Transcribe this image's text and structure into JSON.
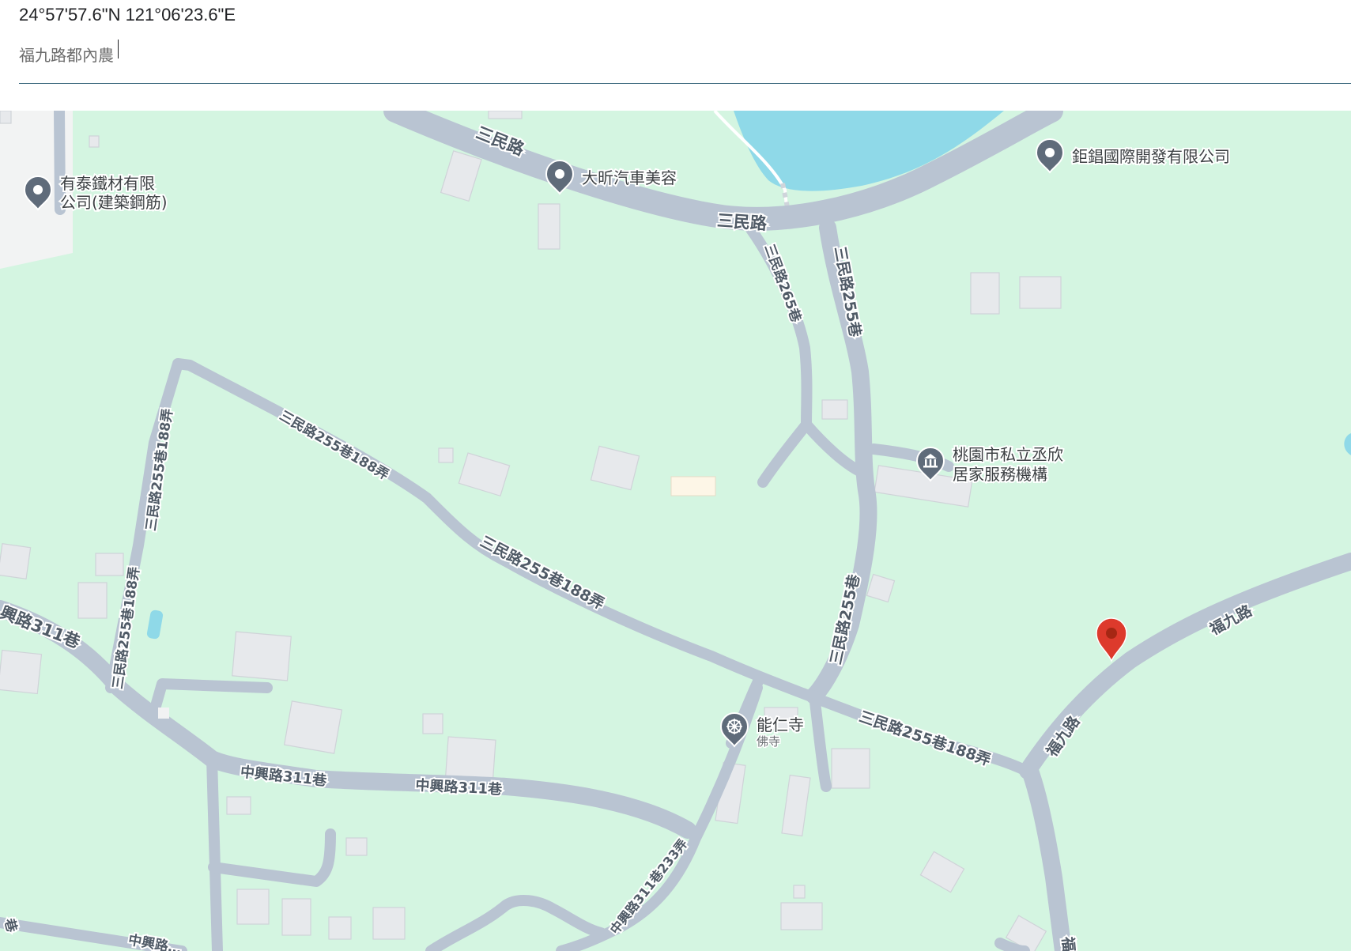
{
  "header": {
    "coordinates": "24°57'57.6\"N 121°06'23.6\"E",
    "search_value": "福九路都內農"
  },
  "map": {
    "colors": {
      "land": "#d4f5e1",
      "road": "#b9c4d2",
      "water": "#8fd9e8",
      "building": "#e7e9ec",
      "marker": "#dd3a2c"
    },
    "road_labels": {
      "sanmin_top_left": "三民路",
      "sanmin_top_mid": "三民路",
      "sanmin_265": "三民路265巷",
      "sanmin_255_top": "三民路255巷",
      "sanmin_255_bottom": "三民路255巷",
      "lane188_upper": "三民路255巷188弄",
      "lane188_mid": "三民路255巷188弄",
      "lane188_lower": "三民路255巷188弄",
      "lane188_vertical": "三民路255巷188弄",
      "lane188_vertical2": "三民路255巷188弄",
      "zhongxing311_left": "興路311巷",
      "zhongxing311_a": "中興路311巷",
      "zhongxing311_b": "中興路311巷",
      "zhongxing233": "中興路311巷233弄",
      "zhongxing_bottom": "中興路…",
      "fujiu_upper": "福九路",
      "fujiu_lower": "福九路",
      "fujiu_bottom": "福",
      "edge_left": "巷"
    },
    "pois": {
      "youtai": {
        "line1": "有泰鐵材有限",
        "line2": "公司(建築鋼筋)",
        "icon": "place-pin-icon"
      },
      "daxin": {
        "label": "大昕汽車美容",
        "icon": "place-pin-icon"
      },
      "juchang": {
        "label": "鉅錩國際開發有限公司",
        "icon": "place-pin-icon"
      },
      "taoyuan": {
        "line1": "桃園市私立丞欣",
        "line2": "居家服務機構",
        "icon": "government-building-icon"
      },
      "nengren": {
        "label": "能仁寺",
        "sub": "佛寺",
        "icon": "dharma-wheel-icon"
      }
    }
  }
}
